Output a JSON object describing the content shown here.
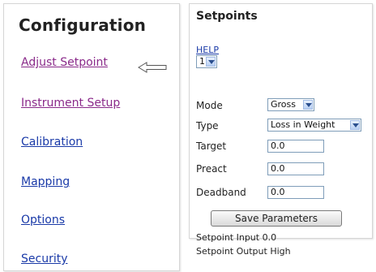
{
  "configuration": {
    "title": "Configuration",
    "links": [
      {
        "label": "Adjust Setpoint"
      },
      {
        "label": "Instrument Setup"
      },
      {
        "label": "Calibration"
      },
      {
        "label": "Mapping"
      },
      {
        "label": "Options"
      },
      {
        "label": "Security"
      }
    ],
    "pointer_icon": "left-arrow-icon"
  },
  "setpoints": {
    "title": "Setpoints",
    "help_label": "HELP",
    "setpoint_number": "1",
    "mode_label": "Mode",
    "mode_value": "Gross",
    "type_label": "Type",
    "type_value": "Loss in Weight",
    "target_label": "Target",
    "target_value": "0.0",
    "preact_label": "Preact",
    "preact_value": "0.0",
    "deadband_label": "Deadband",
    "deadband_value": "0.0",
    "save_label": "Save Parameters",
    "input_text": "Setpoint Input 0.0",
    "output_text": "Setpoint Output High"
  },
  "colors": {
    "link": "#1a3aa8",
    "visited_link": "#8a2a8a",
    "select_border": "#7f9db9"
  }
}
